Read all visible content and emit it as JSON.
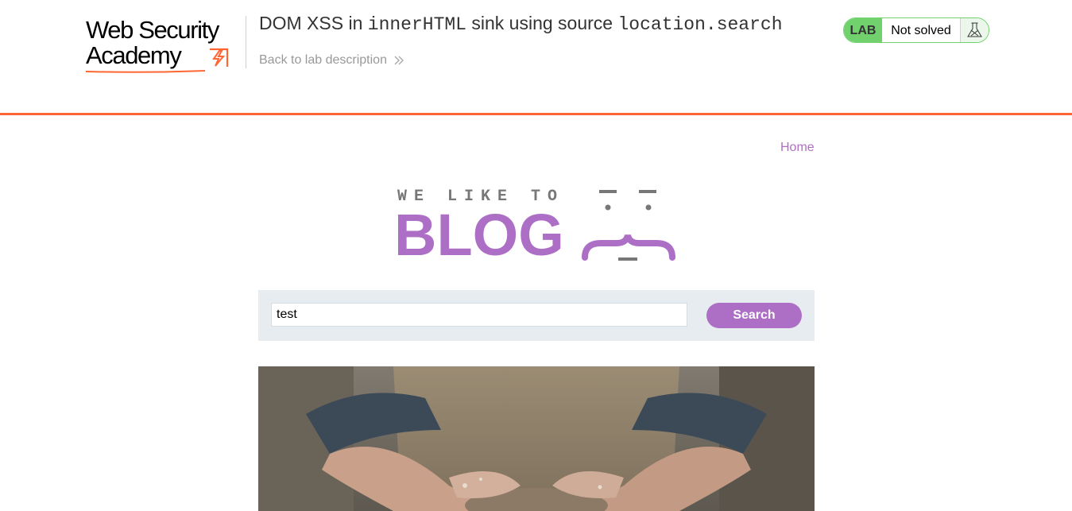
{
  "header": {
    "logo_line1": "Web Security",
    "logo_line2": "Academy",
    "title_prefix": "DOM XSS in ",
    "title_code1": "innerHTML",
    "title_middle": " sink using source ",
    "title_code2": "location.search",
    "back_link": "Back to lab description",
    "status_label": "LAB",
    "status_text": "Not solved",
    "status_icon": "flask-icon"
  },
  "nav": {
    "home": "Home"
  },
  "banner": {
    "tagline": "WE LIKE TO",
    "word": "BLOG"
  },
  "search": {
    "value": "test",
    "button_label": "Search"
  },
  "colors": {
    "accent_orange": "#ff6633",
    "blog_purple": "#ad6fc5",
    "lab_green": "#70d16d"
  }
}
